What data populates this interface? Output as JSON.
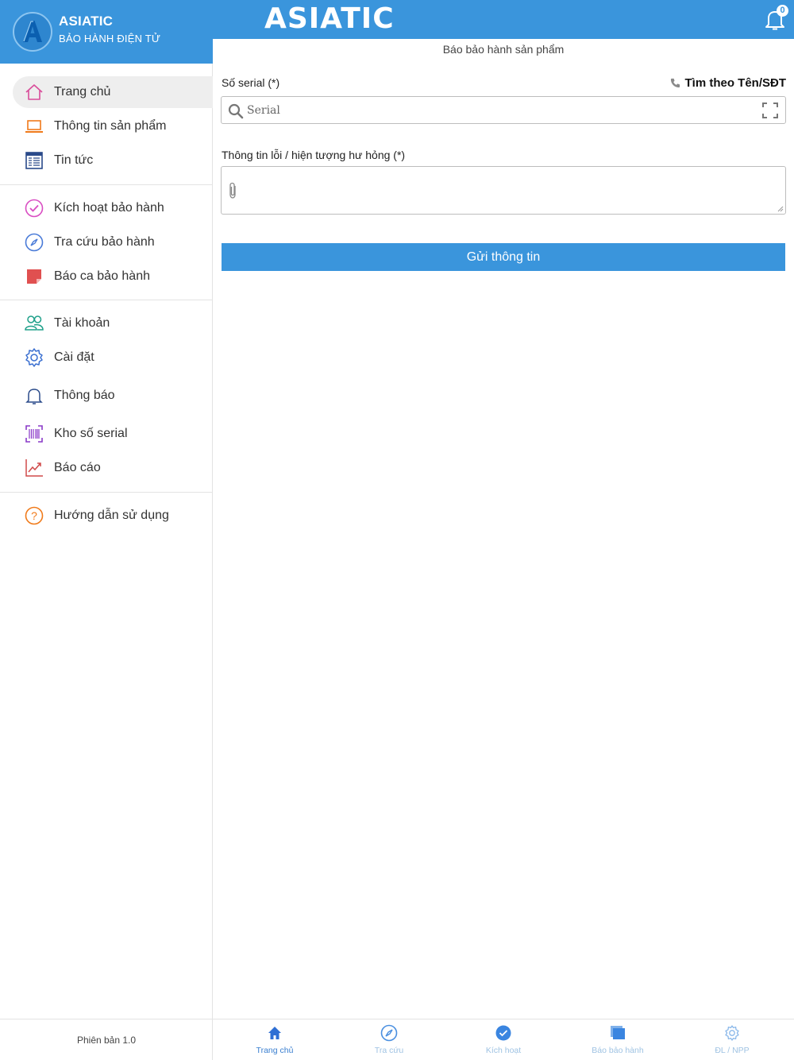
{
  "sidebar": {
    "brand_name": "ASIATIC",
    "brand_sub": "BẢO HÀNH ĐIỆN TỬ",
    "items": [
      {
        "label": "Trang chủ",
        "icon": "home-icon",
        "active": true
      },
      {
        "label": "Thông tin sản phẩm",
        "icon": "laptop-icon"
      },
      {
        "label": "Tin tức",
        "icon": "news-icon"
      },
      {
        "label": "Kích hoạt bảo hành",
        "icon": "check-circle-icon"
      },
      {
        "label": "Tra cứu bảo hành",
        "icon": "compass-icon"
      },
      {
        "label": "Báo ca bảo hành",
        "icon": "note-icon"
      },
      {
        "label": "Tài khoản",
        "icon": "users-icon"
      },
      {
        "label": "Cài đặt",
        "icon": "gear-icon"
      },
      {
        "label": "Thông báo",
        "icon": "bell-icon"
      },
      {
        "label": "Kho số serial",
        "icon": "barcode-icon"
      },
      {
        "label": "Báo cáo",
        "icon": "chart-icon"
      },
      {
        "label": "Hướng dẫn sử dụng",
        "icon": "help-icon"
      }
    ],
    "version": "Phiên bản 1.0"
  },
  "header": {
    "title": "ASIATIC",
    "notification_count": "0"
  },
  "main": {
    "subtitle": "Báo bảo hành sản phẩm",
    "serial_label": "Số serial (*)",
    "search_by_label": "Tìm theo Tên/SĐT",
    "serial_placeholder": "Serial",
    "serial_value": "",
    "error_label": "Thông tin lỗi / hiện tượng hư hỏng (*)",
    "error_value": "",
    "submit_label": "Gửi thông tin"
  },
  "tabbar": {
    "tabs": [
      {
        "label": "Trang chủ",
        "icon": "home-icon",
        "active": true
      },
      {
        "label": "Tra cứu",
        "icon": "compass-icon"
      },
      {
        "label": "Kích hoạt",
        "icon": "check-circle-icon"
      },
      {
        "label": "Báo bảo hành",
        "icon": "copy-icon"
      },
      {
        "label": "ĐL / NPP",
        "icon": "gear-icon"
      }
    ]
  },
  "colors": {
    "accent": "#3a95dc",
    "active_menu_bg": "#eeeeee"
  }
}
